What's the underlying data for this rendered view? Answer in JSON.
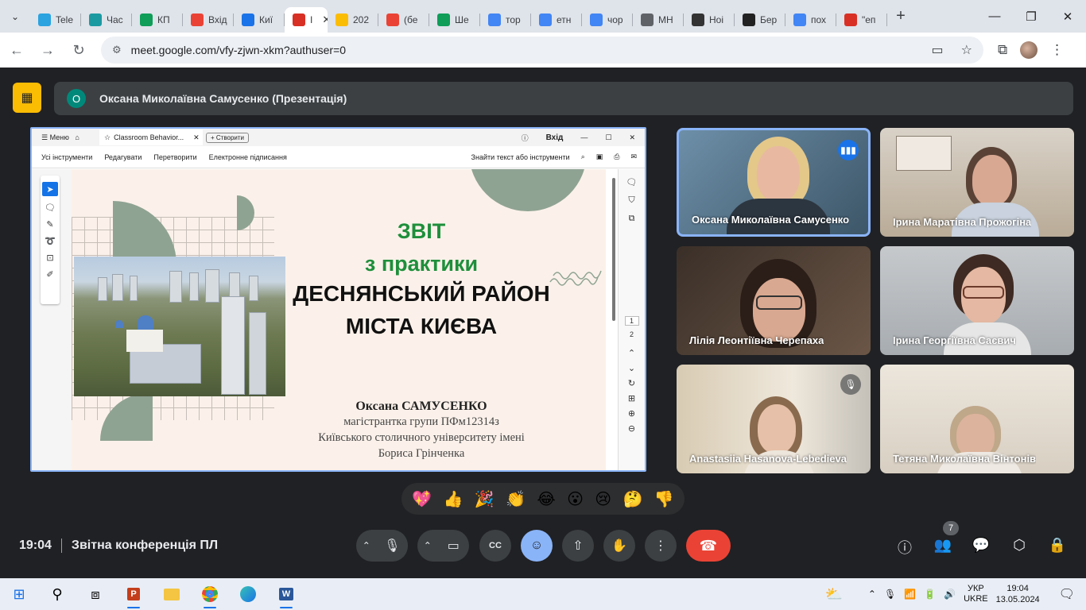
{
  "browser": {
    "tabs": [
      {
        "label": "Tele",
        "icon": "telegram-icon",
        "color": "#2aa3e0"
      },
      {
        "label": "Час",
        "icon": "shield-icon",
        "color": "#1b9aa1"
      },
      {
        "label": "КП",
        "icon": "kpi-icon",
        "color": "#0f9d58"
      },
      {
        "label": "Вхід",
        "icon": "gmail-icon",
        "color": "#ea4335"
      },
      {
        "label": "Киї",
        "icon": "calendar-icon",
        "color": "#1a73e8"
      },
      {
        "label": "I",
        "icon": "record-icon",
        "color": "#d93025"
      },
      {
        "label": "202",
        "icon": "drive-icon",
        "color": "#fbbc04"
      },
      {
        "label": "(бе",
        "icon": "gmail-icon",
        "color": "#ea4335"
      },
      {
        "label": "Ше",
        "icon": "drive-icon",
        "color": "#0f9d58"
      },
      {
        "label": "тор",
        "icon": "google-icon",
        "color": "#4285f4"
      },
      {
        "label": "етн",
        "icon": "google-icon",
        "color": "#4285f4"
      },
      {
        "label": "чор",
        "icon": "google-icon",
        "color": "#4285f4"
      },
      {
        "label": "МН",
        "icon": "globe-icon",
        "color": "#5f6368"
      },
      {
        "label": "Ноі",
        "icon": "github-icon",
        "color": "#333333"
      },
      {
        "label": "Бер",
        "icon": "wikipedia-icon",
        "color": "#222222"
      },
      {
        "label": "пох",
        "icon": "google-icon",
        "color": "#4285f4"
      },
      {
        "label": "\"еп",
        "icon": "pdf-icon",
        "color": "#d93025"
      }
    ],
    "url": "meet.google.com/vfy-zjwn-xkm?authuser=0"
  },
  "meet": {
    "presenter_initial": "O",
    "presenter_label": "Оксана Миколаївна Самусенко (Презентація)",
    "time": "19:04",
    "meeting_title": "Звітна конференція ПЛ",
    "participant_count": "7",
    "reactions": [
      "💖",
      "👍",
      "🎉",
      "👏",
      "😂",
      "😮",
      "😢",
      "🤔",
      "👎"
    ],
    "participants": [
      "Оксана Миколаївна Самусенко",
      "Ірина Маратівна Прожогіна",
      "Лілія Леонтіївна Черепаха",
      "Ірина Георгіївна Саєвич",
      "Anastasiia Hasanova-Lebedieva",
      "Тетяна Миколаївна Вінтонів"
    ]
  },
  "acrobat": {
    "menu": "Меню",
    "tab_title": "Classroom Behavior...",
    "new_button": "Створити",
    "sign_in": "Вхід",
    "tools": [
      "Усі інструменти",
      "Редагувати",
      "Перетворити",
      "Електронне підписання"
    ],
    "find_text": "Знайти текст або інструменти",
    "pages": [
      "1",
      "2"
    ]
  },
  "slide": {
    "title_line1": "ЗВІТ",
    "title_line2": "з практики",
    "district_line1": "ДЕСНЯНСЬКИЙ РАЙОН",
    "district_line2": "МІСТА КИЄВА",
    "author": "Оксана САМУСЕНКО",
    "line1": "магістрантка групи ПФм12314з",
    "line2": "Київського столичного університету імені",
    "line3": "Бориса Грінченка"
  },
  "taskbar": {
    "lang_top": "УКР",
    "lang_bottom": "UKRE",
    "clock": "19:04",
    "date": "13.05.2024"
  },
  "colors": {
    "meet_bg": "#202124",
    "accent_blue": "#8ab4f8",
    "end_call_red": "#ea4335",
    "title_green": "#1e8f3b",
    "sage": "#8fa393"
  }
}
